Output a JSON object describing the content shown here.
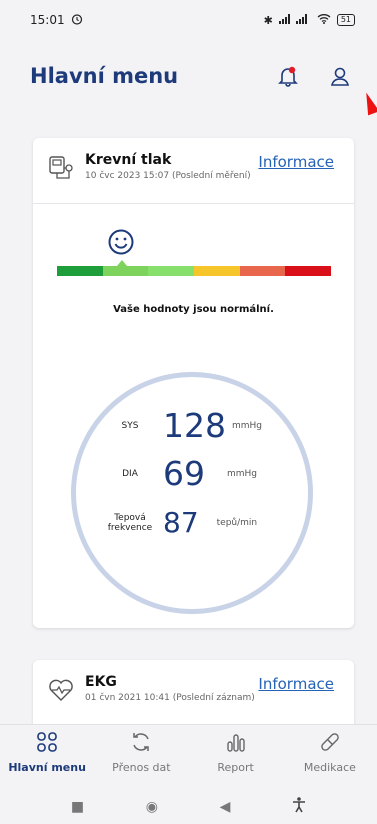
{
  "status": {
    "time": "15:01",
    "battery": "51"
  },
  "header": {
    "title": "Hlavní menu"
  },
  "bp_card": {
    "title": "Krevní tlak",
    "subtitle": "10 čvc 2023 15:07 (Poslední měření)",
    "info_link": "Informace",
    "status_text": "Vaše hodnoty jsou normální.",
    "scale_colors": [
      "#1e9e3a",
      "#7dd35b",
      "#86e06b",
      "#f5c52a",
      "#e8674c",
      "#d9101a"
    ],
    "scale_position_segment": 2,
    "sys_label": "SYS",
    "sys_value": "128",
    "sys_unit": "mmHg",
    "dia_label": "DIA",
    "dia_value": "69",
    "dia_unit": "mmHg",
    "pulse_label_1": "Tepová",
    "pulse_label_2": "frekvence",
    "pulse_value": "87",
    "pulse_unit": "tepů/min"
  },
  "ekg_card": {
    "title": "EKG",
    "subtitle": "01 čvn 2021 10:41 (Poslední záznam)",
    "info_link": "Informace"
  },
  "bottom_nav": {
    "items": [
      {
        "label": "Hlavní menu",
        "icon": "dashboard-icon",
        "active": true
      },
      {
        "label": "Přenos dat",
        "icon": "sync-icon",
        "active": false
      },
      {
        "label": "Report",
        "icon": "chart-icon",
        "active": false
      },
      {
        "label": "Medikace",
        "icon": "pill-icon",
        "active": false
      }
    ]
  },
  "colors": {
    "accent": "#1d3a7a",
    "link": "#2563b6",
    "notification_dot": "#e11d2a"
  }
}
